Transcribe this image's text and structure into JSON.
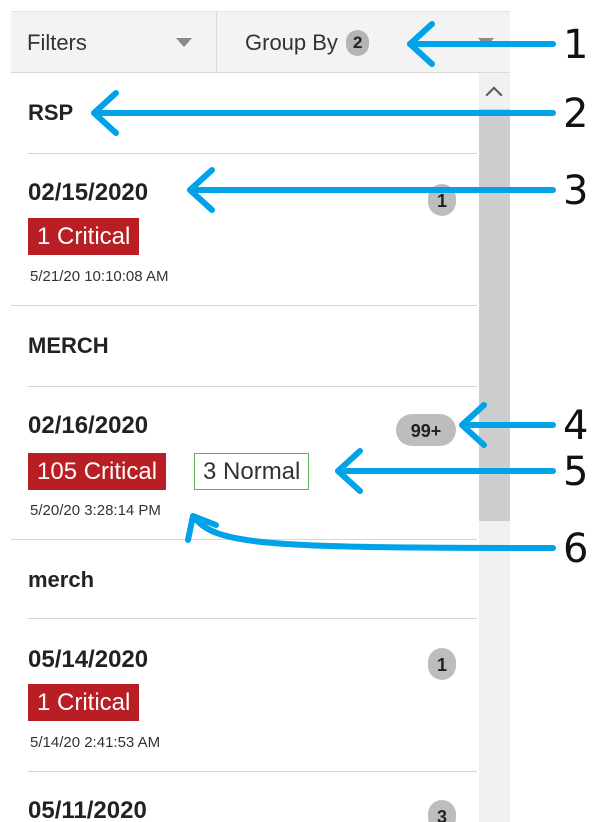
{
  "toolbar": {
    "filters_label": "Filters",
    "groupby_label": "Group By",
    "groupby_count": "2"
  },
  "groups": [
    {
      "name": "RSP"
    },
    {
      "name": "MERCH"
    },
    {
      "name": "merch"
    }
  ],
  "items": [
    {
      "date": "02/15/2020",
      "count": "1",
      "critical": "1 Critical",
      "timestamp": "5/21/20 10:10:08 AM"
    },
    {
      "date": "02/16/2020",
      "count": "99+",
      "critical": "105 Critical",
      "normal": "3 Normal",
      "timestamp": "5/20/20 3:28:14 PM"
    },
    {
      "date": "05/14/2020",
      "count": "1",
      "critical": "1 Critical",
      "timestamp": "5/14/20 2:41:53 AM"
    },
    {
      "date": "05/11/2020",
      "count": "3"
    }
  ],
  "callouts": [
    "1",
    "2",
    "3",
    "4",
    "5",
    "6"
  ],
  "colors": {
    "critical": "#b81e23",
    "normal_border": "#5db65d",
    "arrow": "#00a2e8",
    "badge": "#bdbdbd"
  }
}
